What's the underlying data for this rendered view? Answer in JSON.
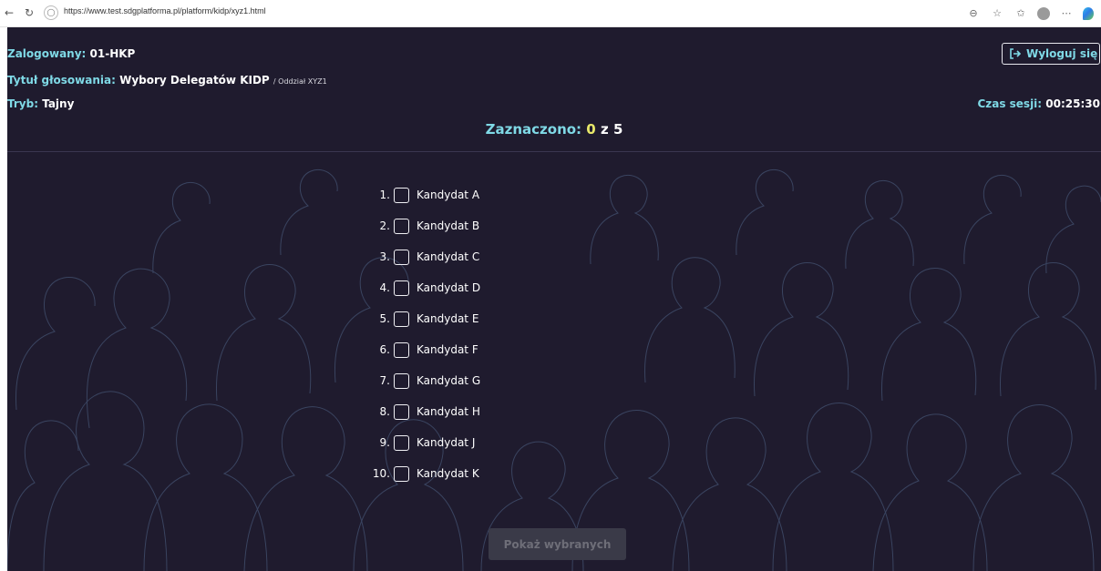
{
  "browser": {
    "url": "https://www.test.sdgplatforma.pl/platform/kidp/xyz1.html"
  },
  "header": {
    "logged_label": "Zalogowany:",
    "logged_value": "01-HKP",
    "title_label": "Tytuł głosowania:",
    "title_value": "Wybory Delegatów KIDP",
    "title_suffix": "/ Oddział XYZ1",
    "mode_label": "Tryb:",
    "mode_value": "Tajny",
    "logout_label": "Wyloguj się",
    "session_label": "Czas sesji:",
    "session_value": "00:25:30"
  },
  "counter": {
    "label": "Zaznaczono:",
    "selected": "0",
    "of": "z",
    "total": "5"
  },
  "candidates": [
    {
      "num": "1.",
      "name": "Kandydat A"
    },
    {
      "num": "2.",
      "name": "Kandydat B"
    },
    {
      "num": "3.",
      "name": "Kandydat C"
    },
    {
      "num": "4.",
      "name": "Kandydat D"
    },
    {
      "num": "5.",
      "name": "Kandydat E"
    },
    {
      "num": "6.",
      "name": "Kandydat F"
    },
    {
      "num": "7.",
      "name": "Kandydat G"
    },
    {
      "num": "8.",
      "name": "Kandydat H"
    },
    {
      "num": "9.",
      "name": "Kandydat J"
    },
    {
      "num": "10.",
      "name": "Kandydat K"
    }
  ],
  "actions": {
    "show_selected_label": "Pokaż wybranych"
  },
  "colors": {
    "background": "#1f1b2e",
    "accent": "#7fd9e6",
    "counter_number": "#e8e86a",
    "button_disabled": "#3a3a48"
  }
}
